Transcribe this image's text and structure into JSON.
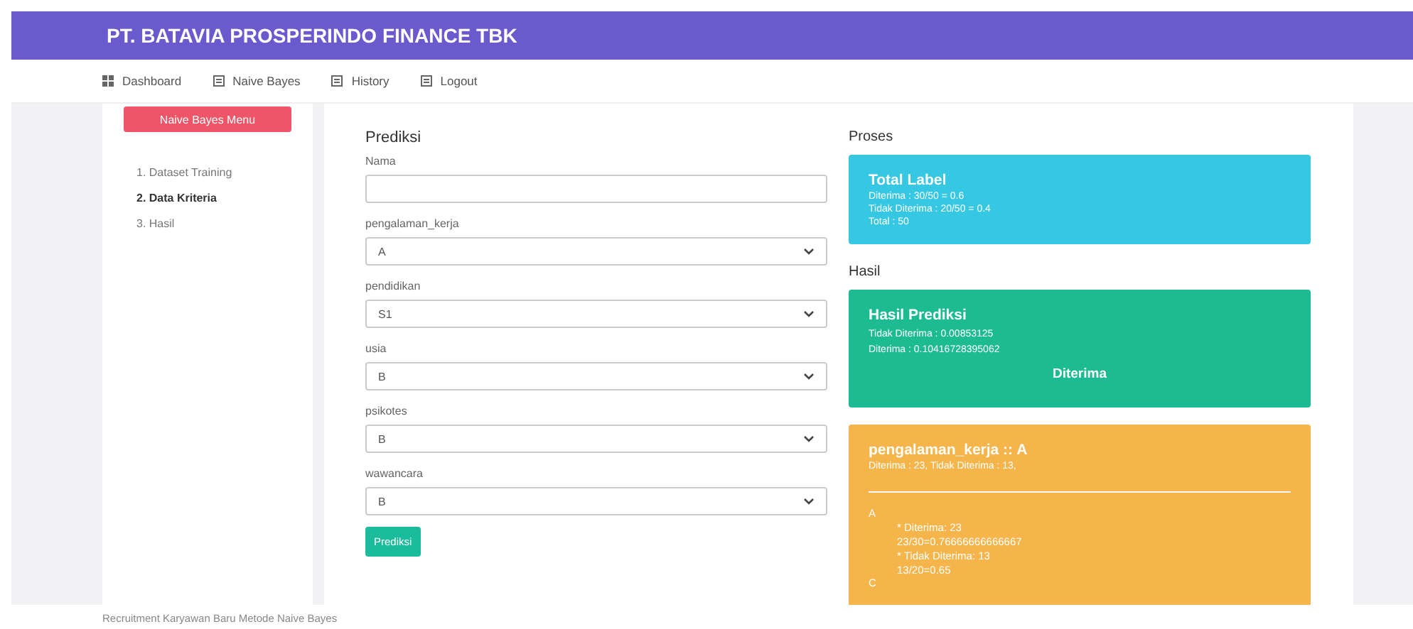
{
  "header": {
    "title": "PT. BATAVIA PROSPERINDO FINANCE TBK"
  },
  "nav": [
    {
      "label": "Dashboard"
    },
    {
      "label": "Naive Bayes"
    },
    {
      "label": "History"
    },
    {
      "label": "Logout"
    }
  ],
  "sidebar": {
    "menu_button": "Naive Bayes Menu",
    "items": [
      {
        "label": "1. Dataset Training",
        "selected": false
      },
      {
        "label": "2. Data Kriteria",
        "selected": true
      },
      {
        "label": "3. Hasil",
        "selected": false
      }
    ]
  },
  "form": {
    "title": "Prediksi",
    "fields": [
      {
        "kind": "text",
        "label": "Nama"
      },
      {
        "kind": "select",
        "label": "pengalaman_kerja",
        "value": "A"
      },
      {
        "kind": "select",
        "label": "pendidikan",
        "value": "S1"
      },
      {
        "kind": "select",
        "label": "usia",
        "value": "B"
      },
      {
        "kind": "select",
        "label": "psikotes",
        "value": "B"
      },
      {
        "kind": "select",
        "label": "wawancara",
        "value": "B"
      }
    ],
    "submit": "Prediksi"
  },
  "proses": {
    "heading": "Proses",
    "card": {
      "title": "Total Label",
      "lines": [
        "Diterima : 30/50 = 0.6",
        "Tidak Diterima : 20/50 = 0.4",
        "Total : 50"
      ]
    }
  },
  "hasil": {
    "heading": "Hasil",
    "card": {
      "title": "Hasil Prediksi",
      "lines": [
        "Tidak Diterima : 0.00853125",
        "Diterima : 0.10416728395062"
      ],
      "result": "Diterima"
    }
  },
  "detail": {
    "title": "pengalaman_kerja :: A",
    "summary": "Diterima : 23, Tidak Diterima : 13,",
    "groups": [
      {
        "value": "A",
        "lines": [
          "* Diterima: 23",
          "23/30=0.76666666666667",
          "* Tidak Diterima: 13",
          "13/20=0.65"
        ]
      },
      {
        "value": "C"
      }
    ]
  },
  "footer": "Recruitment Karyawan Baru Metode Naive Bayes"
}
